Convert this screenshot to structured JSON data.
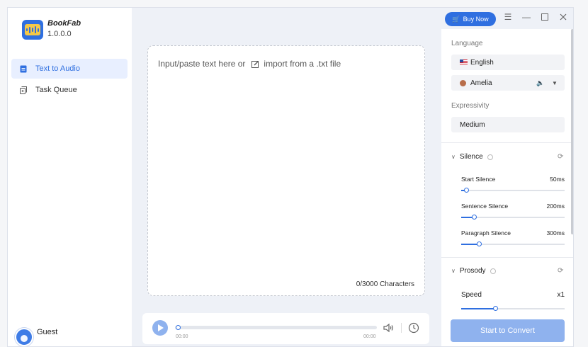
{
  "app": {
    "name": "BookFab",
    "version": "1.0.0.0"
  },
  "sidebar": {
    "items": [
      {
        "label": "Text to Audio",
        "icon": "document-icon",
        "active": true
      },
      {
        "label": "Task Queue",
        "icon": "queue-icon",
        "active": false
      }
    ],
    "user": "Guest"
  },
  "topbar": {
    "buy_label": "Buy Now"
  },
  "editor": {
    "placeholder_prefix": "Input/paste text here or",
    "import_link": "import from a .txt file",
    "char_count": "0/3000 Characters"
  },
  "player": {
    "current_time": "00:00",
    "total_time": "00:00",
    "progress": 0
  },
  "settings": {
    "language_label": "Language",
    "language": "English",
    "voice": "Amelia",
    "expressivity_label": "Expressivity",
    "expressivity": "Medium",
    "silence": {
      "title": "Silence",
      "items": [
        {
          "label": "Start Silence",
          "value": "50ms",
          "fraction": 0.05
        },
        {
          "label": "Sentence Silence",
          "value": "200ms",
          "fraction": 0.12
        },
        {
          "label": "Paragraph Silence",
          "value": "300ms",
          "fraction": 0.17
        }
      ]
    },
    "prosody": {
      "title": "Prosody",
      "items": [
        {
          "label": "Speed",
          "value": "x1",
          "fraction": 0.33
        }
      ]
    }
  },
  "convert_label": "Start to Convert",
  "colors": {
    "accent": "#2f6fe0",
    "accent_light": "#8fb2ee"
  }
}
